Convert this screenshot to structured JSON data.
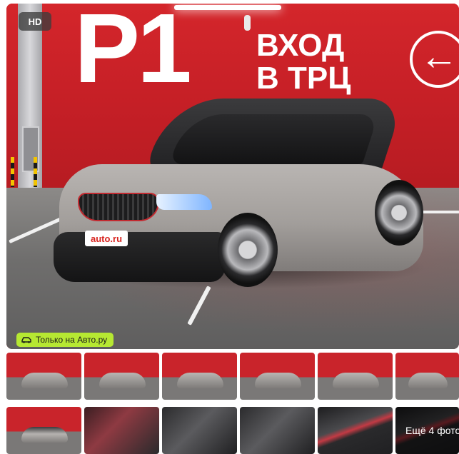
{
  "main_photo": {
    "hd_badge": "HD",
    "only_badge_label": "Только на Авто.ру",
    "scene_text": {
      "parking_level": "P1",
      "entrance_line1": "ВХОД",
      "entrance_line2": "В ТРЦ",
      "plate_text": "auto.ru"
    }
  },
  "thumbnails": [
    {
      "kind": "exterior",
      "name": "thumb-1"
    },
    {
      "kind": "exterior",
      "name": "thumb-2"
    },
    {
      "kind": "exterior",
      "name": "thumb-3"
    },
    {
      "kind": "exterior",
      "name": "thumb-4"
    },
    {
      "kind": "exterior",
      "name": "thumb-5"
    },
    {
      "kind": "exterior",
      "name": "thumb-6"
    },
    {
      "kind": "exterior",
      "name": "thumb-7"
    },
    {
      "kind": "interior",
      "name": "thumb-8"
    },
    {
      "kind": "interior",
      "name": "thumb-9"
    },
    {
      "kind": "interior",
      "name": "thumb-10"
    },
    {
      "kind": "interior",
      "name": "thumb-11"
    },
    {
      "kind": "interior",
      "name": "thumb-12"
    }
  ],
  "more_photos_label": "Ещё 4 фото",
  "colors": {
    "wall_red": "#c51f26",
    "badge_green": "#b6e832",
    "hd_badge_bg": "#3c3c3c"
  }
}
